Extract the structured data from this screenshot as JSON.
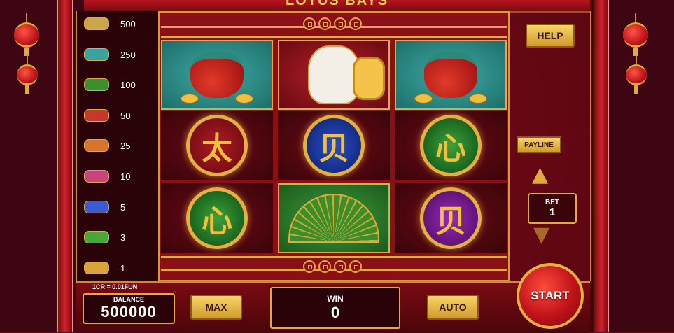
{
  "game": {
    "title": "LOTUS BAYS"
  },
  "paytable": [
    {
      "icon": "gold-bars-icon",
      "color": "#caa64a",
      "value": "500"
    },
    {
      "icon": "lantern-stack-icon",
      "color": "#3aa3a0",
      "value": "250"
    },
    {
      "icon": "fan-icon",
      "color": "#3f8f30",
      "value": "100"
    },
    {
      "icon": "red-coin-icon",
      "color": "#c33a2a",
      "value": "50"
    },
    {
      "icon": "orange-coin-icon",
      "color": "#d8742a",
      "value": "25"
    },
    {
      "icon": "pink-coin-icon",
      "color": "#c9447a",
      "value": "10"
    },
    {
      "icon": "blue-coin-icon",
      "color": "#3a5bd1",
      "value": "5"
    },
    {
      "icon": "green-coin-icon",
      "color": "#4aa63a",
      "value": "3"
    },
    {
      "icon": "yellow-coin-icon",
      "color": "#d9a53a",
      "value": "1"
    }
  ],
  "reels": {
    "row1": [
      {
        "name": "money-bag-symbol",
        "style": "teal"
      },
      {
        "name": "lucky-cat-symbol",
        "style": "red"
      },
      {
        "name": "money-bag-symbol",
        "style": "teal"
      }
    ],
    "row2": [
      {
        "name": "red-medal-symbol",
        "glyph": "太",
        "color": "red"
      },
      {
        "name": "blue-medal-symbol",
        "glyph": "贝",
        "color": "blue"
      },
      {
        "name": "green-medal-symbol",
        "glyph": "心",
        "color": "green"
      }
    ],
    "row3": [
      {
        "name": "green-medal-symbol",
        "glyph": "心",
        "color": "green"
      },
      {
        "name": "fan-symbol",
        "style": "green"
      },
      {
        "name": "purple-medal-symbol",
        "glyph": "贝",
        "color": "purple"
      }
    ]
  },
  "controls": {
    "help_label": "HELP",
    "payline_label": "PAYLINE",
    "bet_label": "BET",
    "bet_value": "1",
    "max_label": "MAX",
    "auto_label": "AUTO",
    "start_label": "START"
  },
  "balance": {
    "rate": "1CR = 0.01FUN",
    "label": "BALANCE",
    "value": "500000"
  },
  "win": {
    "label": "WIN",
    "value": "0"
  },
  "colors": {
    "gold": "#e2a93b",
    "red": "#b8141d",
    "dark": "#2a0309"
  }
}
